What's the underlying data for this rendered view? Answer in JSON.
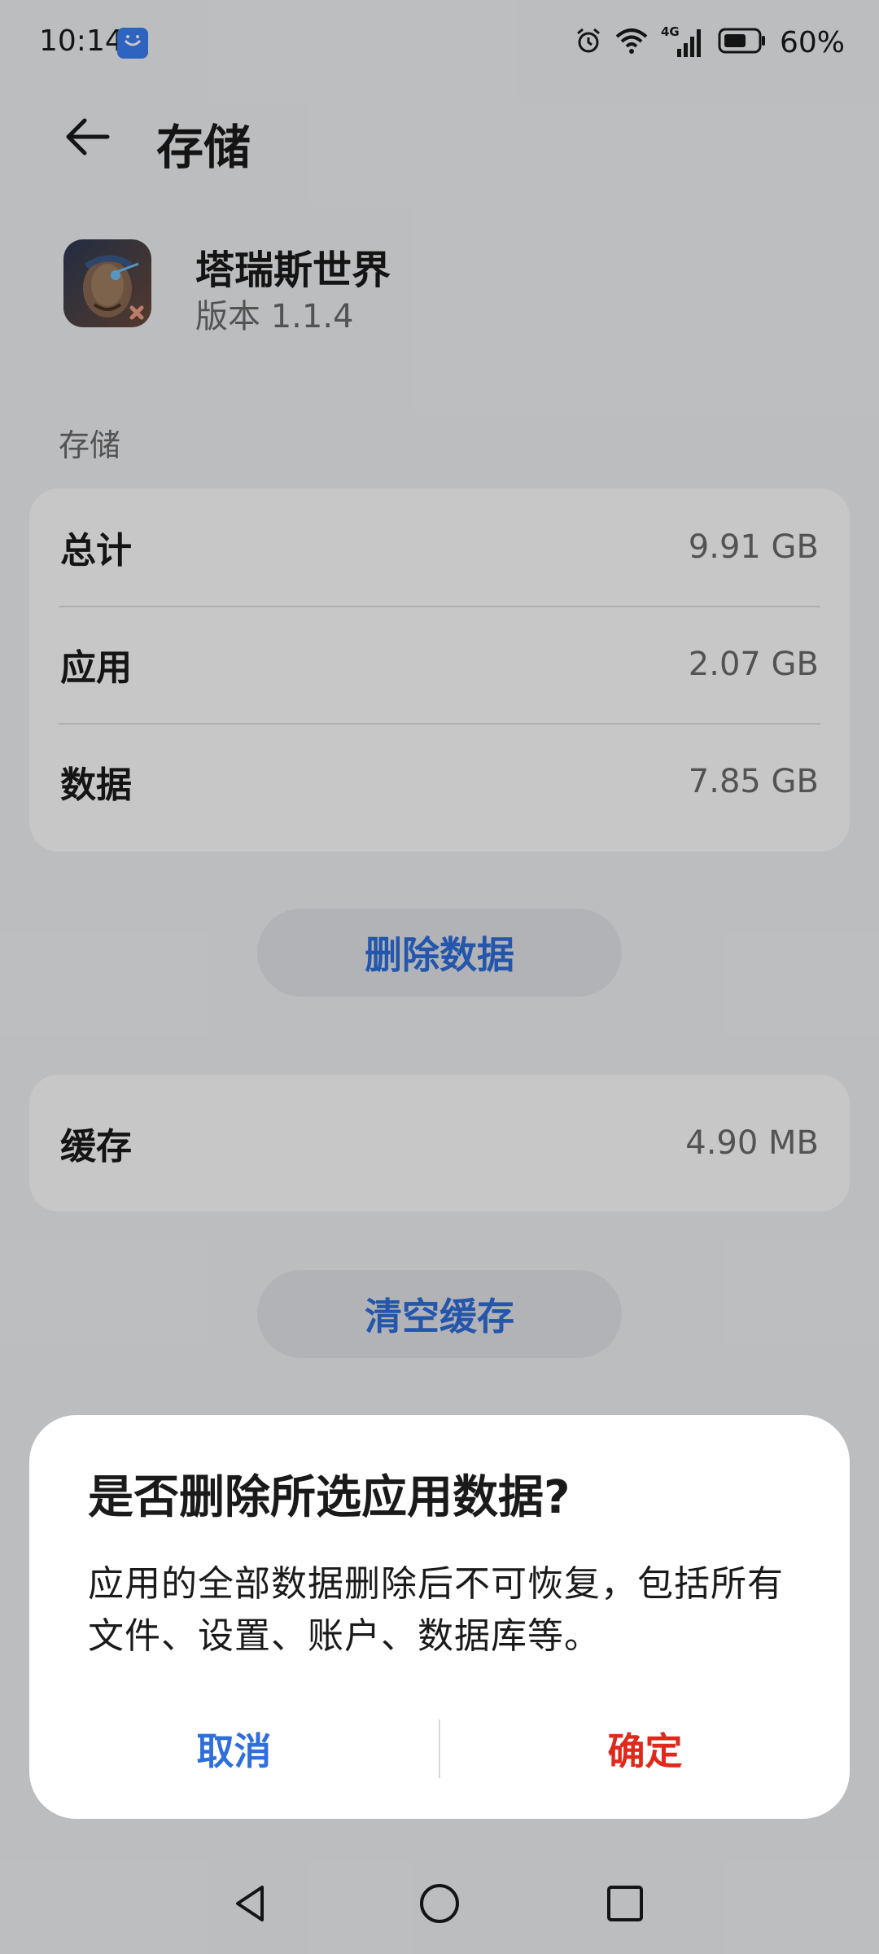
{
  "status_bar": {
    "time": "10:14",
    "network": "4G",
    "battery": "60%",
    "icons": [
      "alarm-icon",
      "wifi-icon",
      "signal-icon",
      "battery-icon"
    ]
  },
  "header": {
    "title": "存储",
    "back_icon": "arrow-left-icon"
  },
  "app": {
    "name": "塔瑞斯世界",
    "version": "版本 1.1.4"
  },
  "storage": {
    "section_label": "存储",
    "rows": [
      {
        "label": "总计",
        "value": "9.91 GB"
      },
      {
        "label": "应用",
        "value": "2.07 GB"
      },
      {
        "label": "数据",
        "value": "7.85 GB"
      }
    ],
    "delete_button": "删除数据"
  },
  "cache": {
    "label": "缓存",
    "value": "4.90 MB",
    "clear_button": "清空缓存"
  },
  "dialog": {
    "title": "是否删除所选应用数据?",
    "message": "应用的全部数据删除后不可恢复，包括所有文件、设置、账户、数据库等。",
    "cancel": "取消",
    "confirm": "确定"
  },
  "colors": {
    "accent": "#2f6fdb",
    "danger": "#e0281c"
  }
}
